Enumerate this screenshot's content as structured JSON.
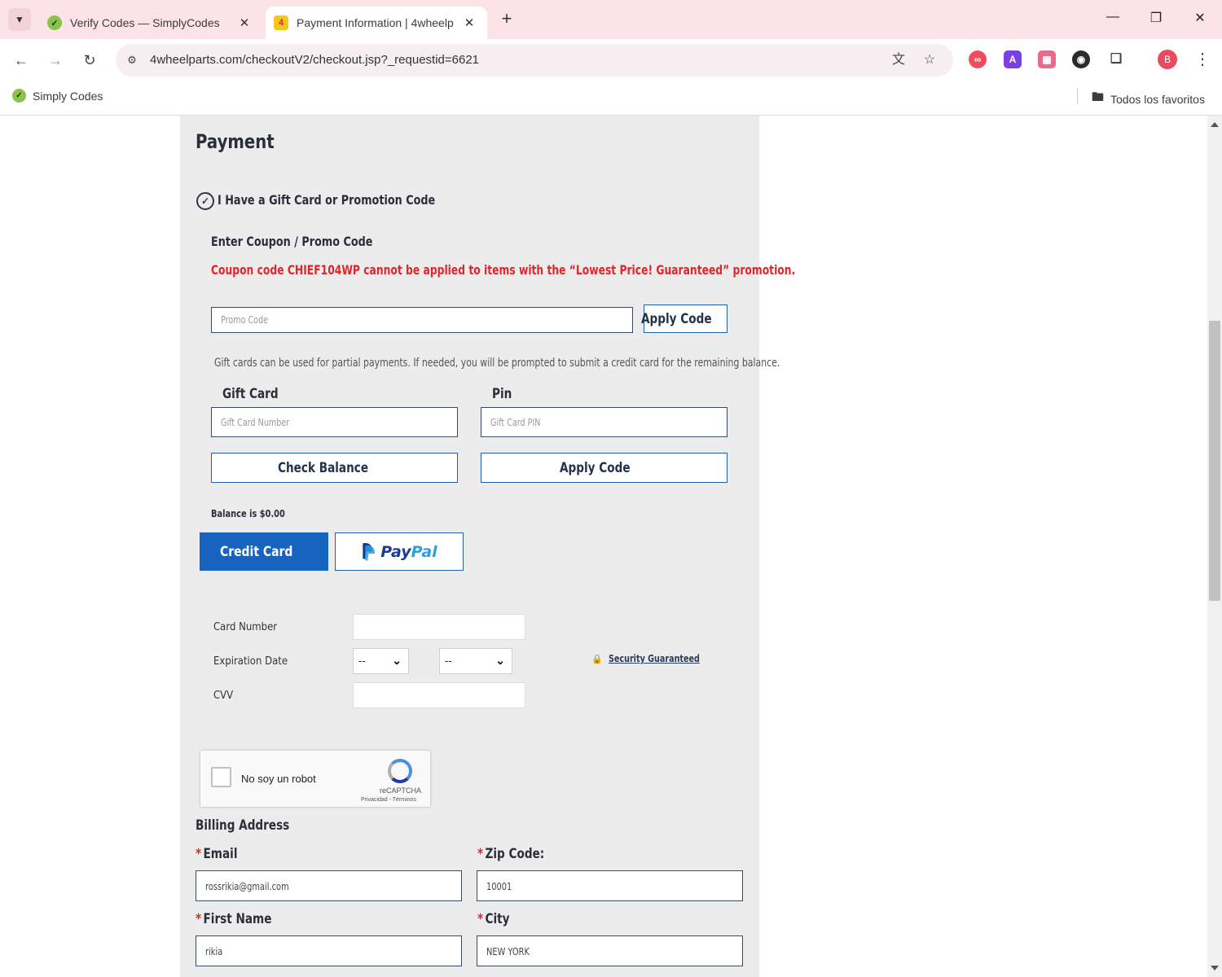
{
  "browser": {
    "tabs": [
      {
        "title": "Verify Codes — SimplyCodes",
        "favicon": "simplycodes-icon",
        "active": false
      },
      {
        "title": "Payment Information | 4wheelp",
        "favicon": "4wheelparts-icon",
        "active": true
      }
    ],
    "url": "4wheelparts.com/checkoutV2/checkout.jsp?_requestid=6621",
    "profile_initial": "B",
    "bookmarks": [
      {
        "label": "Simply Codes"
      }
    ],
    "bookmarks_folder": "Todos los favoritos"
  },
  "payment": {
    "heading": "Payment",
    "gift_toggle_label": "I Have a Gift Card or Promotion Code",
    "coupon_heading": "Enter Coupon / Promo Code",
    "coupon_error": "Coupon code CHIEF104WP cannot be applied to items with the “Lowest Price! Guaranteed” promotion.",
    "promo_placeholder": "Promo Code",
    "apply_code_label": "Apply Code",
    "gift_note": "Gift cards can be used for partial payments. If needed, you will be prompted to submit a credit card for the remaining balance.",
    "gift_card_label": "Gift Card",
    "gift_card_placeholder": "Gift Card Number",
    "pin_label": "Pin",
    "pin_placeholder": "Gift Card PIN",
    "check_balance_label": "Check Balance",
    "gift_apply_label": "Apply Code",
    "balance_text": "Balance is $0.00",
    "methods": {
      "credit_card": "Credit Card",
      "paypal_pay": "Pay",
      "paypal_pal": "Pal"
    },
    "card": {
      "number_label": "Card Number",
      "expiration_label": "Expiration Date",
      "month_value": "--",
      "year_value": "--",
      "cvv_label": "CVV",
      "security_link": "Security Guaranteed"
    },
    "recaptcha": {
      "label": "No soy un robot",
      "brand": "reCAPTCHA",
      "terms": "Privacidad - Términos"
    }
  },
  "billing": {
    "heading": "Billing Address",
    "required_mark": "*",
    "email_label": "Email",
    "email_value": "rossrikia@gmail.com",
    "zip_label": "Zip Code:",
    "zip_value": "10001",
    "first_name_label": "First Name",
    "first_name_value": "rikia",
    "city_label": "City",
    "city_value": "NEW YORK"
  }
}
